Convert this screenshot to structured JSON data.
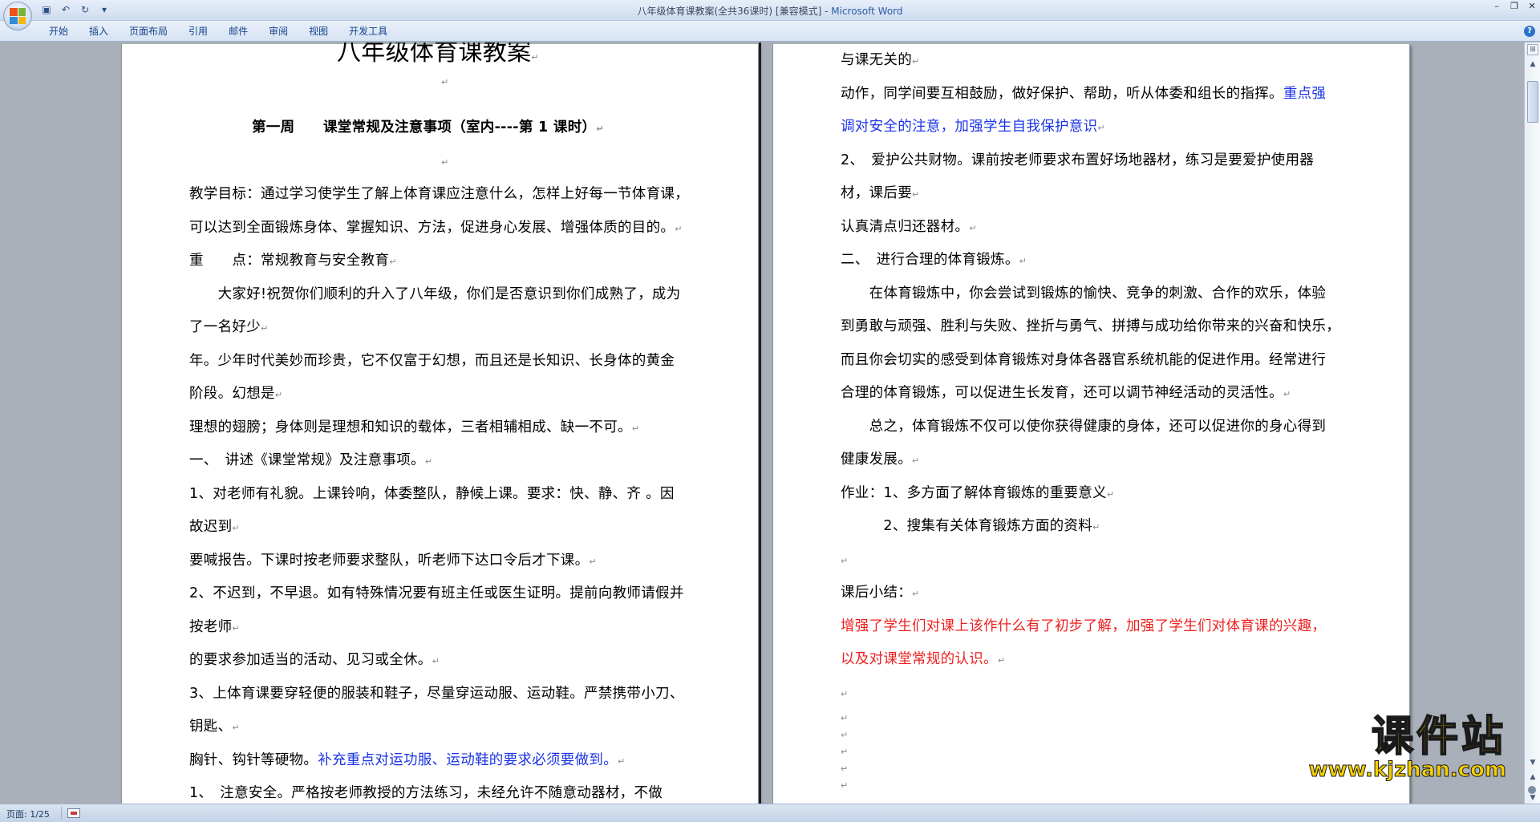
{
  "window": {
    "title_doc": "八年级体育课教案(全共36课时) [兼容模式] - ",
    "title_app": "Microsoft Word"
  },
  "ribbon": {
    "tabs": [
      "开始",
      "插入",
      "页面布局",
      "引用",
      "邮件",
      "审阅",
      "视图",
      "开发工具"
    ]
  },
  "page_left": {
    "title": "八年级体育课教案",
    "week_heading": "第一周　　课堂常规及注意事项（室内----第 1 课时）",
    "goal_1": "教学目标：通过学习使学生了解上体育课应注意什么，怎样上好每一节体育课，",
    "goal_2": "可以达到全面锻炼身体、掌握知识、方法，促进身心发展、增强体质的目的。",
    "key_point": "重　　点：常规教育与安全教育",
    "greeting_1": "　　大家好!祝贺你们顺利的升入了八年级，你们是否意识到你们成熟了，成为",
    "greeting_2": "了一名好少",
    "greeting_3": "年。少年时代美妙而珍贵，它不仅富于幻想，而且还是长知识、长身体的黄金",
    "greeting_4": "阶段。幻想是",
    "greeting_5": "理想的翅膀；身体则是理想和知识的载体，三者相辅相成、缺一不可。",
    "section_1": "一、　讲述《课堂常规》及注意事项。",
    "rule_1a": "1、对老师有礼貌。上课铃响，体委整队，静候上课。要求：快、静、齐 。因",
    "rule_1b": "故迟到",
    "rule_1c": "要喊报告。下课时按老师要求整队，听老师下达口令后才下课。",
    "rule_2a": "2、不迟到，不早退。如有特殊情况要有班主任或医生证明。提前向教师请假并",
    "rule_2b": "按老师",
    "rule_2c": "的要求参加适当的活动、见习或全休。",
    "rule_3a": "3、上体育课要穿轻便的服装和鞋子，尽量穿运动服、运动鞋。严禁携带小刀、",
    "rule_3b": "钥匙、",
    "rule_3c_black": "胸针、钩针等硬物。",
    "rule_3c_blue": "补充重点对运功服、运动鞋的要求必须要做到。",
    "rule_4a": "1、　注意安全。严格按老师教授的方法练习，未经允许不随意动器材，不做"
  },
  "page_right": {
    "r1": "与课无关的",
    "r2_black": "动作，同学间要互相鼓励，做好保护、帮助，听从体委和组长的指挥。",
    "r2_blue": "重点强",
    "r3_blue": "调对安全的注意，加强学生自我保护意识",
    "r4": "2、　爱护公共财物。课前按老师要求布置好场地器材，练习是要爱护使用器",
    "r5": "材，课后要",
    "r6": "认真清点归还器材。",
    "r7": "二、　进行合理的体育锻炼。",
    "r8": "　　在体育锻炼中，你会尝试到锻炼的愉快、竞争的刺激、合作的欢乐，体验",
    "r9": "到勇敢与顽强、胜利与失败、挫折与勇气、拼搏与成功给你带来的兴奋和快乐，",
    "r10": "而且你会切实的感受到体育锻炼对身体各器官系统机能的促进作用。经常进行",
    "r11": "合理的体育锻炼，可以促进生长发育，还可以调节神经活动的灵活性。",
    "r12": "　　总之，体育锻炼不仅可以使你获得健康的身体，还可以促进你的身心得到",
    "r13": "健康发展。",
    "r14": "作业：1、多方面了解体育锻炼的重要意义",
    "r15": "　　　2、搜集有关体育锻炼方面的资料",
    "r16": "课后小结：",
    "r17_red": "增强了学生们对课上该作什么有了初步了解，加强了学生们对体育课的兴趣，",
    "r18_red": "以及对课堂常规的认识。"
  },
  "paragraph_mark": "↵",
  "statusbar": {
    "page_count": "页面: 1/25"
  },
  "watermark": {
    "main": "课件站",
    "url": "www.kjzhan.com"
  },
  "colors": {
    "emphasis_blue": "#1a33e6",
    "emphasis_red": "#ef1e1e",
    "workspace_gray": "#a9b0b9"
  }
}
